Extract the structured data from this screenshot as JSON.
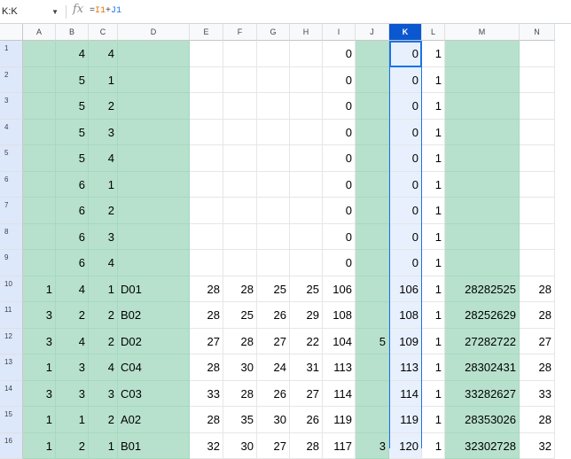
{
  "formula_bar": {
    "name_box": "K:K",
    "fx_icon": "function-icon",
    "formula_prefix": "=",
    "formula_ref1": "I1",
    "formula_op": "+",
    "formula_ref2": "J1"
  },
  "columns": [
    "A",
    "B",
    "C",
    "D",
    "E",
    "F",
    "G",
    "H",
    "I",
    "J",
    "K",
    "L",
    "M",
    "N"
  ],
  "selected_column": "K",
  "green_columns": [
    "A",
    "B",
    "C",
    "D",
    "J",
    "M"
  ],
  "rows": [
    {
      "n": "1",
      "cells": {
        "A": "",
        "B": "4",
        "C": "4",
        "D": "",
        "E": "",
        "F": "",
        "G": "",
        "H": "",
        "I": "0",
        "J": "",
        "K": "0",
        "L": "1",
        "M": "",
        "N": ""
      }
    },
    {
      "n": "2",
      "cells": {
        "A": "",
        "B": "5",
        "C": "1",
        "D": "",
        "E": "",
        "F": "",
        "G": "",
        "H": "",
        "I": "0",
        "J": "",
        "K": "0",
        "L": "1",
        "M": "",
        "N": ""
      }
    },
    {
      "n": "3",
      "cells": {
        "A": "",
        "B": "5",
        "C": "2",
        "D": "",
        "E": "",
        "F": "",
        "G": "",
        "H": "",
        "I": "0",
        "J": "",
        "K": "0",
        "L": "1",
        "M": "",
        "N": ""
      }
    },
    {
      "n": "4",
      "cells": {
        "A": "",
        "B": "5",
        "C": "3",
        "D": "",
        "E": "",
        "F": "",
        "G": "",
        "H": "",
        "I": "0",
        "J": "",
        "K": "0",
        "L": "1",
        "M": "",
        "N": ""
      }
    },
    {
      "n": "5",
      "cells": {
        "A": "",
        "B": "5",
        "C": "4",
        "D": "",
        "E": "",
        "F": "",
        "G": "",
        "H": "",
        "I": "0",
        "J": "",
        "K": "0",
        "L": "1",
        "M": "",
        "N": ""
      }
    },
    {
      "n": "6",
      "cells": {
        "A": "",
        "B": "6",
        "C": "1",
        "D": "",
        "E": "",
        "F": "",
        "G": "",
        "H": "",
        "I": "0",
        "J": "",
        "K": "0",
        "L": "1",
        "M": "",
        "N": ""
      }
    },
    {
      "n": "7",
      "cells": {
        "A": "",
        "B": "6",
        "C": "2",
        "D": "",
        "E": "",
        "F": "",
        "G": "",
        "H": "",
        "I": "0",
        "J": "",
        "K": "0",
        "L": "1",
        "M": "",
        "N": ""
      }
    },
    {
      "n": "8",
      "cells": {
        "A": "",
        "B": "6",
        "C": "3",
        "D": "",
        "E": "",
        "F": "",
        "G": "",
        "H": "",
        "I": "0",
        "J": "",
        "K": "0",
        "L": "1",
        "M": "",
        "N": ""
      }
    },
    {
      "n": "9",
      "cells": {
        "A": "",
        "B": "6",
        "C": "4",
        "D": "",
        "E": "",
        "F": "",
        "G": "",
        "H": "",
        "I": "0",
        "J": "",
        "K": "0",
        "L": "1",
        "M": "",
        "N": ""
      }
    },
    {
      "n": "10",
      "cells": {
        "A": "1",
        "B": "4",
        "C": "1",
        "D": "D01",
        "E": "28",
        "F": "28",
        "G": "25",
        "H": "25",
        "I": "106",
        "J": "",
        "K": "106",
        "L": "1",
        "M": "28282525",
        "N": "28"
      }
    },
    {
      "n": "11",
      "cells": {
        "A": "3",
        "B": "2",
        "C": "2",
        "D": "B02",
        "E": "28",
        "F": "25",
        "G": "26",
        "H": "29",
        "I": "108",
        "J": "",
        "K": "108",
        "L": "1",
        "M": "28252629",
        "N": "28"
      }
    },
    {
      "n": "12",
      "cells": {
        "A": "3",
        "B": "4",
        "C": "2",
        "D": "D02",
        "E": "27",
        "F": "28",
        "G": "27",
        "H": "22",
        "I": "104",
        "J": "5",
        "K": "109",
        "L": "1",
        "M": "27282722",
        "N": "27"
      }
    },
    {
      "n": "13",
      "cells": {
        "A": "1",
        "B": "3",
        "C": "4",
        "D": "C04",
        "E": "28",
        "F": "30",
        "G": "24",
        "H": "31",
        "I": "113",
        "J": "",
        "K": "113",
        "L": "1",
        "M": "28302431",
        "N": "28"
      }
    },
    {
      "n": "14",
      "cells": {
        "A": "3",
        "B": "3",
        "C": "3",
        "D": "C03",
        "E": "33",
        "F": "28",
        "G": "26",
        "H": "27",
        "I": "114",
        "J": "",
        "K": "114",
        "L": "1",
        "M": "33282627",
        "N": "33"
      }
    },
    {
      "n": "15",
      "cells": {
        "A": "1",
        "B": "1",
        "C": "2",
        "D": "A02",
        "E": "28",
        "F": "35",
        "G": "30",
        "H": "26",
        "I": "119",
        "J": "",
        "K": "119",
        "L": "1",
        "M": "28353026",
        "N": "28"
      }
    },
    {
      "n": "16",
      "cells": {
        "A": "1",
        "B": "2",
        "C": "1",
        "D": "B01",
        "E": "32",
        "F": "30",
        "G": "27",
        "H": "28",
        "I": "117",
        "J": "3",
        "K": "120",
        "L": "1",
        "M": "32302728",
        "N": "32"
      }
    }
  ]
}
